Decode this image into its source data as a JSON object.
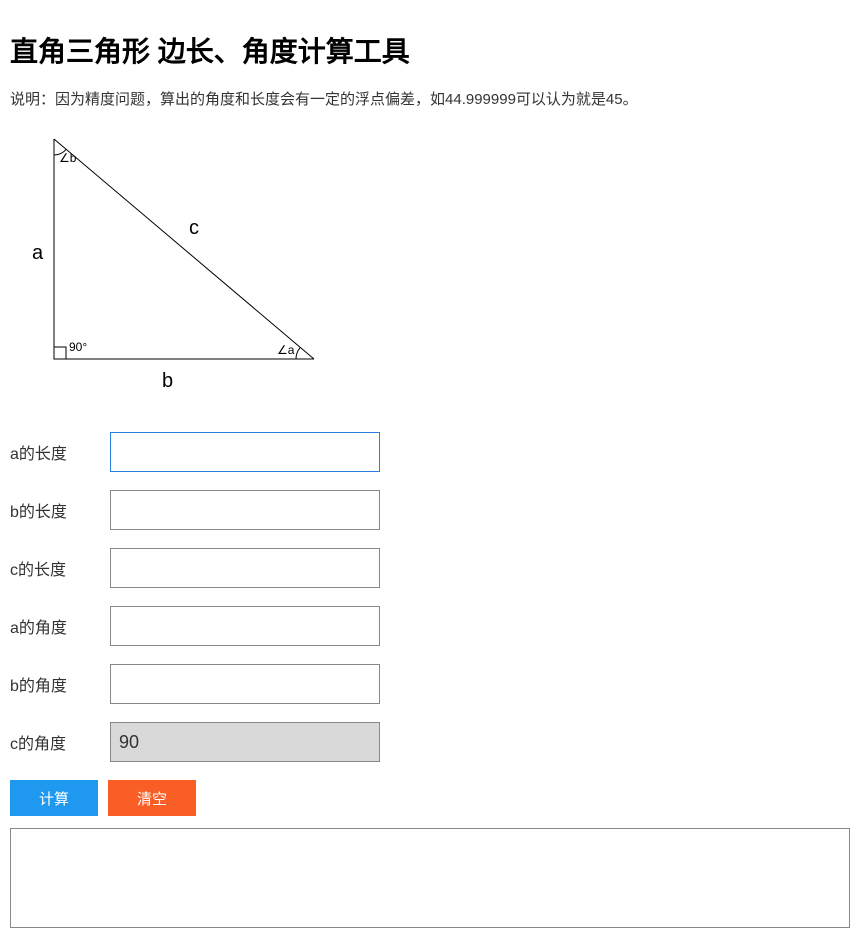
{
  "title": "直角三角形 边长、角度计算工具",
  "description": "说明：因为精度问题，算出的角度和长度会有一定的浮点偏差，如44.999999可以认为就是45。",
  "diagram": {
    "label_a": "a",
    "label_b": "b",
    "label_c": "c",
    "angle_a": "∠a",
    "angle_b": "∠b",
    "angle_90": "90°"
  },
  "fields": {
    "a_length": {
      "label": "a的长度",
      "value": ""
    },
    "b_length": {
      "label": "b的长度",
      "value": ""
    },
    "c_length": {
      "label": "c的长度",
      "value": ""
    },
    "a_angle": {
      "label": "a的角度",
      "value": ""
    },
    "b_angle": {
      "label": "b的角度",
      "value": ""
    },
    "c_angle": {
      "label": "c的角度",
      "value": "90"
    }
  },
  "buttons": {
    "calculate": "计算",
    "clear": "清空"
  },
  "output": ""
}
